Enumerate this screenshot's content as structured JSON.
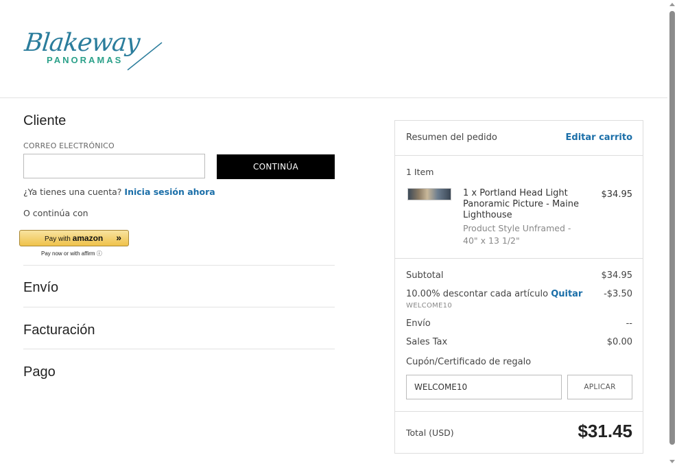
{
  "brand": {
    "name": "Blakeway",
    "sub": "PANORAMAS"
  },
  "checkout": {
    "customer": {
      "title": "Cliente",
      "email_label": "CORREO ELECTRÓNICO",
      "email_value": "",
      "continue_label": "CONTINÚA",
      "account_question": "¿Ya tienes una cuenta?",
      "signin_link": "Inicia sesión ahora",
      "or_continue": "O continúa con",
      "amazon_pay_prefix": "Pay with",
      "amazon_pay_brand": "amazon",
      "affirm_text": "Pay now or with affirm ⓘ"
    },
    "steps": {
      "shipping": "Envío",
      "billing": "Facturación",
      "payment": "Pago"
    }
  },
  "summary": {
    "title": "Resumen del pedido",
    "edit_link": "Editar carrito",
    "items_count": "1 Item",
    "item": {
      "name": "1 x Portland Head Light Panoramic Picture - Maine Lighthouse",
      "price": "$34.95",
      "style": "Product Style Unframed - 40\" x 13 1/2\""
    },
    "subtotal_label": "Subtotal",
    "subtotal_value": "$34.95",
    "discount_label": "10.00% descontar cada artículo",
    "discount_remove": "Quitar",
    "discount_value": "-$3.50",
    "discount_code": "WELCOME10",
    "shipping_label": "Envío",
    "shipping_value": "--",
    "tax_label": "Sales Tax",
    "tax_value": "$0.00",
    "coupon_label": "Cupón/Certificado de regalo",
    "coupon_value": "WELCOME10",
    "apply_label": "APLICAR",
    "total_label": "Total (USD)",
    "total_value": "$31.45"
  },
  "colors": {
    "link": "#1a6ea8",
    "logo_blue": "#2b7d9c",
    "logo_green": "#2aa089",
    "button_dark": "#000000"
  }
}
